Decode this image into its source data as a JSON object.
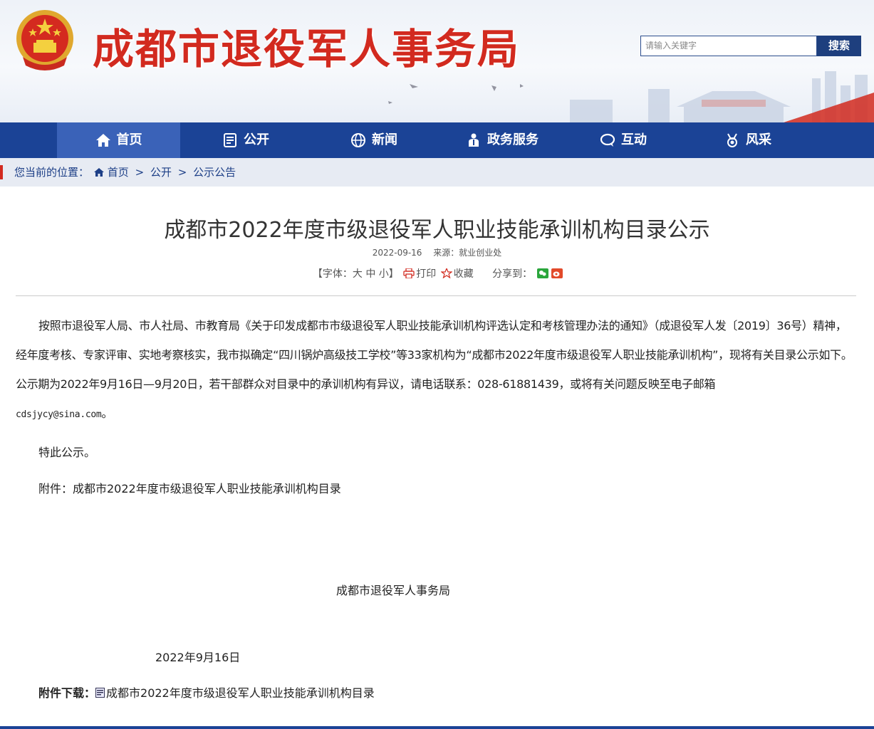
{
  "header": {
    "site_title": "成都市退役军人事务局",
    "search_placeholder": "请输入关键字",
    "search_button": "搜索"
  },
  "nav": {
    "items": [
      {
        "label": "首页",
        "icon": "home-icon",
        "active": true
      },
      {
        "label": "公开",
        "icon": "document-icon",
        "active": false
      },
      {
        "label": "新闻",
        "icon": "globe-icon",
        "active": false
      },
      {
        "label": "政务服务",
        "icon": "service-person-icon",
        "active": false
      },
      {
        "label": "互动",
        "icon": "chat-icon",
        "active": false
      },
      {
        "label": "风采",
        "icon": "medal-icon",
        "active": false
      }
    ]
  },
  "breadcrumb": {
    "prefix": "您当前的位置：",
    "items": [
      "首页",
      "公开",
      "公示公告"
    ],
    "separator": ">"
  },
  "article": {
    "title": "成都市2022年度市级退役军人职业技能承训机构目录公示",
    "date": "2022-09-16",
    "source": "来源：就业创业处",
    "font_size_label": "【字体：大 中 小】",
    "print_label": "打印",
    "favorite_label": "收藏",
    "share_label": "分享到：",
    "body_main": "按照市退役军人局、市人社局、市教育局《关于印发成都市市级退役军人职业技能承训机构评选认定和考核管理办法的通知》（成退役军人发〔2019〕36号）精神，经年度考核、专家评审、实地考察核实，我市拟确定“四川锅炉高级技工学校”等33家机构为“成都市2022年度市级退役军人职业技能承训机构”，现将有关目录公示如下。公示期为2022年9月16日—9月20日，若干部群众对目录中的承训机构有异议，请电话联系：028-61881439，或将有关问题反映至电子邮箱",
    "email": "cdsjycy@sina.com",
    "email_end": "。",
    "notice": "特此公示。",
    "attachment_line": "附件：成都市2022年度市级退役军人职业技能承训机构目录",
    "signature": "成都市退役军人事务局",
    "sign_date": "2022年9月16日",
    "download_label": "附件下载：",
    "download_file": "成都市2022年度市级退役军人职业技能承训机构目录"
  },
  "colors": {
    "nav_bg": "#1b4396",
    "nav_active": "#3a62b8",
    "title_red": "#d22a1f",
    "breadcrumb_bg": "#e7ebf3"
  }
}
